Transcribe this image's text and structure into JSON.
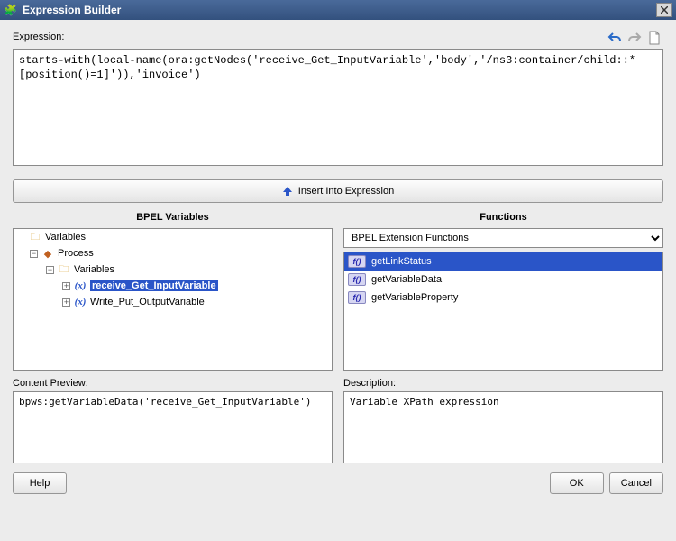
{
  "title": "Expression Builder",
  "labels": {
    "expression": "Expression:",
    "insert": "Insert Into Expression",
    "bpel_vars": "BPEL Variables",
    "functions": "Functions",
    "content_preview": "Content Preview:",
    "description": "Description:"
  },
  "expression_text": "starts-with(local-name(ora:getNodes('receive_Get_InputVariable','body','/ns3:container/child::*[position()=1]')),'invoice')",
  "variables_tree": {
    "root": "Variables",
    "process": "Process",
    "vars_folder": "Variables",
    "items": [
      {
        "name": "receive_Get_InputVariable",
        "selected": true
      },
      {
        "name": "Write_Put_OutputVariable",
        "selected": false
      }
    ]
  },
  "functions": {
    "category": "BPEL Extension Functions",
    "items": [
      {
        "name": "getLinkStatus",
        "selected": true
      },
      {
        "name": "getVariableData",
        "selected": false
      },
      {
        "name": "getVariableProperty",
        "selected": false
      }
    ]
  },
  "content_preview": "bpws:getVariableData('receive_Get_InputVariable')",
  "description": "Variable XPath expression",
  "buttons": {
    "help": "Help",
    "ok": "OK",
    "cancel": "Cancel"
  }
}
